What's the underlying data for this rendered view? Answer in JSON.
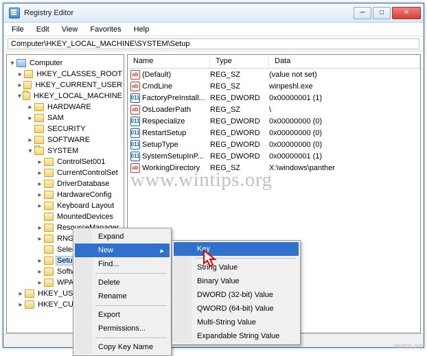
{
  "window": {
    "title": "Registry Editor"
  },
  "menu": {
    "file": "File",
    "edit": "Edit",
    "view": "View",
    "favorites": "Favorites",
    "help": "Help"
  },
  "address": "Computer\\HKEY_LOCAL_MACHINE\\SYSTEM\\Setup",
  "tree": {
    "root": "Computer",
    "hives": {
      "hkcr": "HKEY_CLASSES_ROOT",
      "hkcu": "HKEY_CURRENT_USER",
      "hklm": "HKEY_LOCAL_MACHINE",
      "hku": "HKEY_USE",
      "hkcc": "HKEY_CUR"
    },
    "hklm_children": {
      "hardware": "HARDWARE",
      "sam": "SAM",
      "security": "SECURITY",
      "software": "SOFTWARE",
      "system": "SYSTEM"
    },
    "system_children": {
      "cs001": "ControlSet001",
      "ccs": "CurrentControlSet",
      "driverdb": "DriverDatabase",
      "hwcfg": "HardwareConfig",
      "kbd": "Keyboard Layout",
      "mounted": "MountedDevices",
      "resmgr": "ResourceManager",
      "rng": "RNG",
      "select": "Select",
      "setup": "Setup",
      "softw": "Softw",
      "wpa": "WPA"
    }
  },
  "columns": {
    "name": "Name",
    "type": "Type",
    "data": "Data"
  },
  "rows": [
    {
      "icon": "sz",
      "name": "(Default)",
      "type": "REG_SZ",
      "data": "(value not set)"
    },
    {
      "icon": "sz",
      "name": "CmdLine",
      "type": "REG_SZ",
      "data": "winpeshl.exe"
    },
    {
      "icon": "dw",
      "name": "FactoryPreInstall...",
      "type": "REG_DWORD",
      "data": "0x00000001 (1)"
    },
    {
      "icon": "sz",
      "name": "OsLoaderPath",
      "type": "REG_SZ",
      "data": "\\"
    },
    {
      "icon": "dw",
      "name": "Respecialize",
      "type": "REG_DWORD",
      "data": "0x00000000 (0)"
    },
    {
      "icon": "dw",
      "name": "RestartSetup",
      "type": "REG_DWORD",
      "data": "0x00000000 (0)"
    },
    {
      "icon": "dw",
      "name": "SetupType",
      "type": "REG_DWORD",
      "data": "0x00000000 (0)"
    },
    {
      "icon": "dw",
      "name": "SystemSetupInP...",
      "type": "REG_DWORD",
      "data": "0x00000001 (1)"
    },
    {
      "icon": "sz",
      "name": "WorkingDirectory",
      "type": "REG_SZ",
      "data": "X:\\windows\\panther"
    }
  ],
  "ctx1": {
    "expand": "Expand",
    "new": "New",
    "find": "Find...",
    "delete": "Delete",
    "rename": "Rename",
    "export": "Export",
    "permissions": "Permissions...",
    "copykey": "Copy Key Name"
  },
  "ctx2": {
    "key": "Key",
    "string": "String Value",
    "binary": "Binary Value",
    "dword": "DWORD (32-bit) Value",
    "qword": "QWORD (64-bit) Value",
    "multi": "Multi-String Value",
    "expand": "Expandable String Value"
  },
  "watermark": "www.wintips.org",
  "credit": "wintips.org"
}
